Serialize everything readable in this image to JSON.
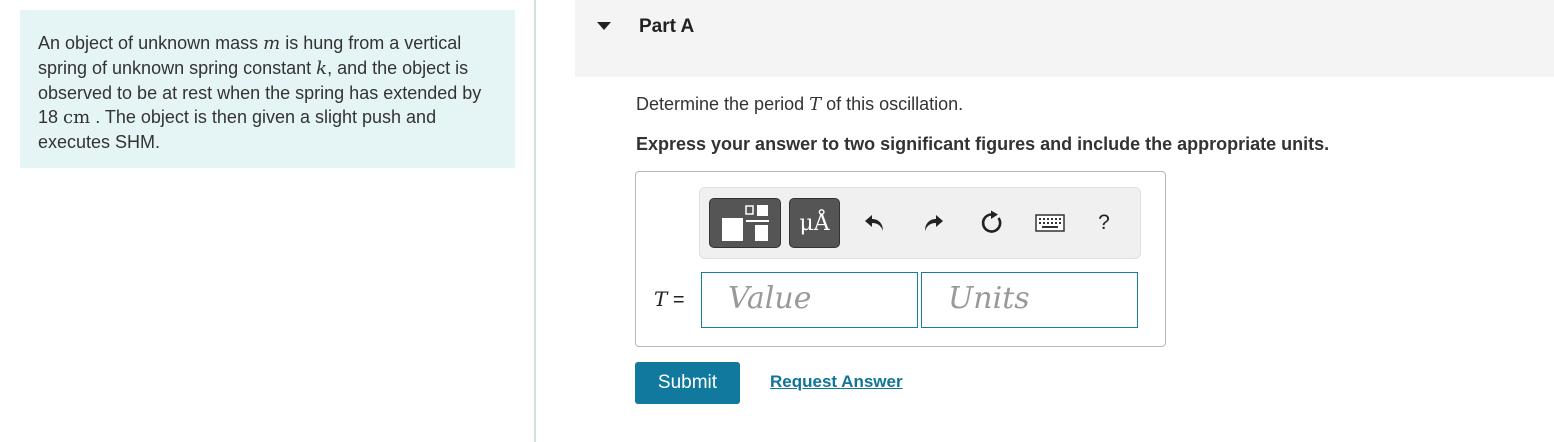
{
  "problem": {
    "s1": "An object of unknown mass ",
    "m": "m",
    "s2": " is hung from a vertical spring of unknown spring constant ",
    "k": "k",
    "s3": ", and the object is observed to be at rest when the spring has extended by 18 ",
    "unit": "cm",
    "s4": " . The object is then given a slight push and executes SHM."
  },
  "part": {
    "title": "Part A"
  },
  "question": {
    "pre": "Determine the period ",
    "var": "T",
    "post": " of this oscillation."
  },
  "instruction": "Express your answer to two significant figures and include the appropriate units.",
  "toolbar": {
    "units_button": "μÅ",
    "help": "?",
    "icons": [
      "fraction-template-icon",
      "units-icon",
      "undo-icon",
      "redo-icon",
      "reset-icon",
      "keyboard-icon",
      "help-icon"
    ]
  },
  "answer": {
    "var": "T",
    "equals": "=",
    "value_placeholder": "Value",
    "units_placeholder": "Units"
  },
  "buttons": {
    "submit": "Submit",
    "request_answer": "Request Answer"
  },
  "colors": {
    "problem_bg": "#e5f5f5",
    "accent": "#10799d",
    "link": "#11749a"
  }
}
